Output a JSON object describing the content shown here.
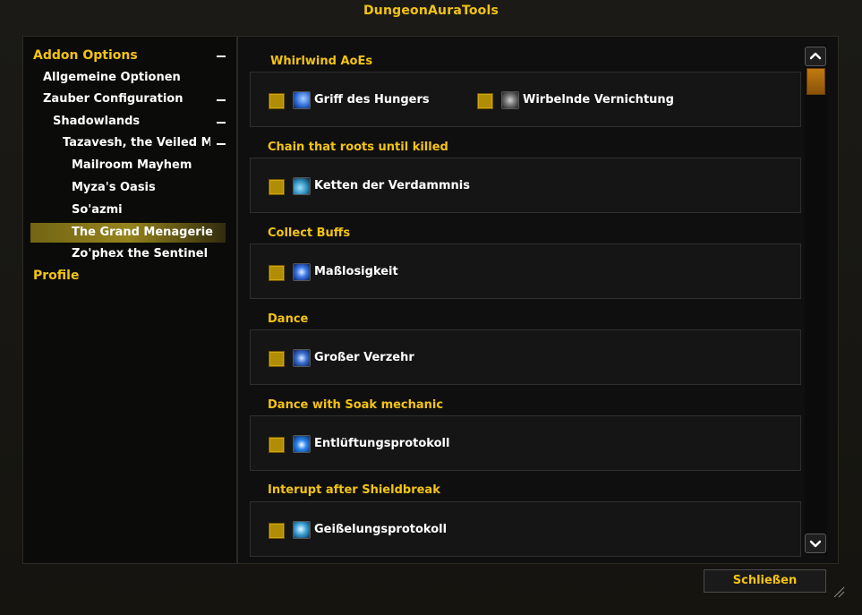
{
  "window": {
    "title": "DungeonAuraTools"
  },
  "tree": {
    "items": [
      {
        "label": "Addon Options",
        "expanded": true
      },
      {
        "label": "Allgemeine Optionen"
      },
      {
        "label": "Zauber Configuration",
        "expanded": true
      },
      {
        "label": "Shadowlands",
        "expanded": true
      },
      {
        "label": "Tazavesh, the Veiled Mark...",
        "expanded": true
      },
      {
        "label": "Mailroom Mayhem"
      },
      {
        "label": "Myza's Oasis"
      },
      {
        "label": "So'azmi"
      },
      {
        "label": "The Grand Menagerie",
        "selected": true
      },
      {
        "label": "Zo'phex the Sentinel"
      },
      {
        "label": "Profile"
      }
    ]
  },
  "groups": [
    {
      "title": "Whirlwind AoEs",
      "items": [
        {
          "label": "Griff des Hungers",
          "icon": "hunger-grip-icon",
          "color": "#2e6ad6"
        },
        {
          "label": "Wirbelnde Vernichtung",
          "icon": "whirling-annihilation-icon",
          "color": "#6c6c6c"
        }
      ]
    },
    {
      "title": "Chain that roots until killed",
      "items": [
        {
          "label": "Ketten der Verdammnis",
          "icon": "chains-icon",
          "color": "#2f8fbd"
        }
      ]
    },
    {
      "title": "Collect Buffs",
      "items": [
        {
          "label": "Maßlosigkeit",
          "icon": "gluttony-icon",
          "color": "#3a77e8"
        }
      ]
    },
    {
      "title": "Dance",
      "items": [
        {
          "label": "Großer Verzehr",
          "icon": "grand-consumption-icon",
          "color": "#3b6fd1"
        }
      ]
    },
    {
      "title": "Dance with Soak mechanic",
      "items": [
        {
          "label": "Entlüftungsprotokoll",
          "icon": "venting-protocol-icon",
          "color": "#2a86f0"
        }
      ]
    },
    {
      "title": "Interupt after Shieldbreak",
      "items": [
        {
          "label": "Geißelungsprotokoll",
          "icon": "scourging-protocol-icon",
          "color": "#3aa1d6"
        }
      ]
    }
  ],
  "footer": {
    "close_label": "Schließen"
  },
  "colors": {
    "accent": "#f3c313",
    "checkbox": "#b18d05",
    "scroll_thumb": "#c17a10"
  }
}
